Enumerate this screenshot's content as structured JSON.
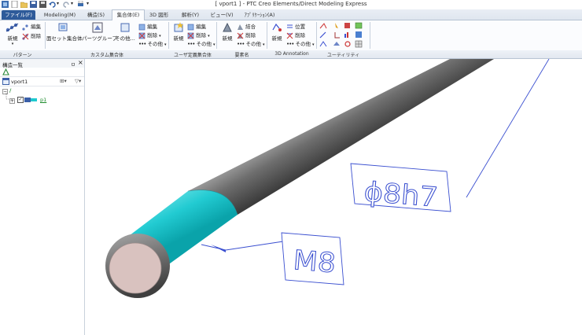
{
  "window": {
    "title": "[ vport1 ] - PTC Creo Elements/Direct Modeling Express"
  },
  "ribbon": {
    "tabs": [
      {
        "label": "ファイル(F)"
      },
      {
        "label": "Modeling(M)"
      },
      {
        "label": "構造(S)"
      },
      {
        "label": "集合体(E)"
      },
      {
        "label": "3D 図形"
      },
      {
        "label": "解析(Y)"
      },
      {
        "label": "ビュー(V)"
      },
      {
        "label": "ｱﾌﾟﾘｹｰｼｮﾝ(A)"
      }
    ],
    "active_tab": "集合体(E)",
    "pattern": {
      "new": "新規",
      "edit": "編集",
      "delete": "削除",
      "group": "パターン"
    },
    "custom_assembly": {
      "dummy_set": "面セット集合体",
      "parts_group": "パーツグループ",
      "other": "その他...",
      "edit": "編集",
      "delete": "削除",
      "other2": "その他",
      "group": "カスタム集合体"
    },
    "user_assembly": {
      "new": "新規",
      "edit": "編集",
      "delete": "削除",
      "other": "その他",
      "group": "ユーザ定義集合体"
    },
    "elements": {
      "new": "新規",
      "combine": "結合",
      "delete": "削除",
      "other": "その他",
      "group": "要素名"
    },
    "annotation3d": {
      "new": "新規",
      "position": "位置",
      "delete": "削除",
      "other": "その他",
      "group": "3D Annotation"
    },
    "utility": {
      "group": "ユーティリティ"
    }
  },
  "panel": {
    "title": "構造一覧",
    "pin": "ㅁ",
    "close": "×",
    "vport": "vport1",
    "tree": [
      {
        "label": "/"
      },
      {
        "label": "p1"
      }
    ]
  },
  "viewport": {
    "annotations": [
      {
        "text": "ϕ8h7"
      },
      {
        "text": "M8"
      }
    ],
    "colors": {
      "shaft": "#6b6b6b",
      "thread": "#1ec9cf",
      "leader": "#3a4fd0",
      "endcap": "#d8bfbd"
    }
  }
}
